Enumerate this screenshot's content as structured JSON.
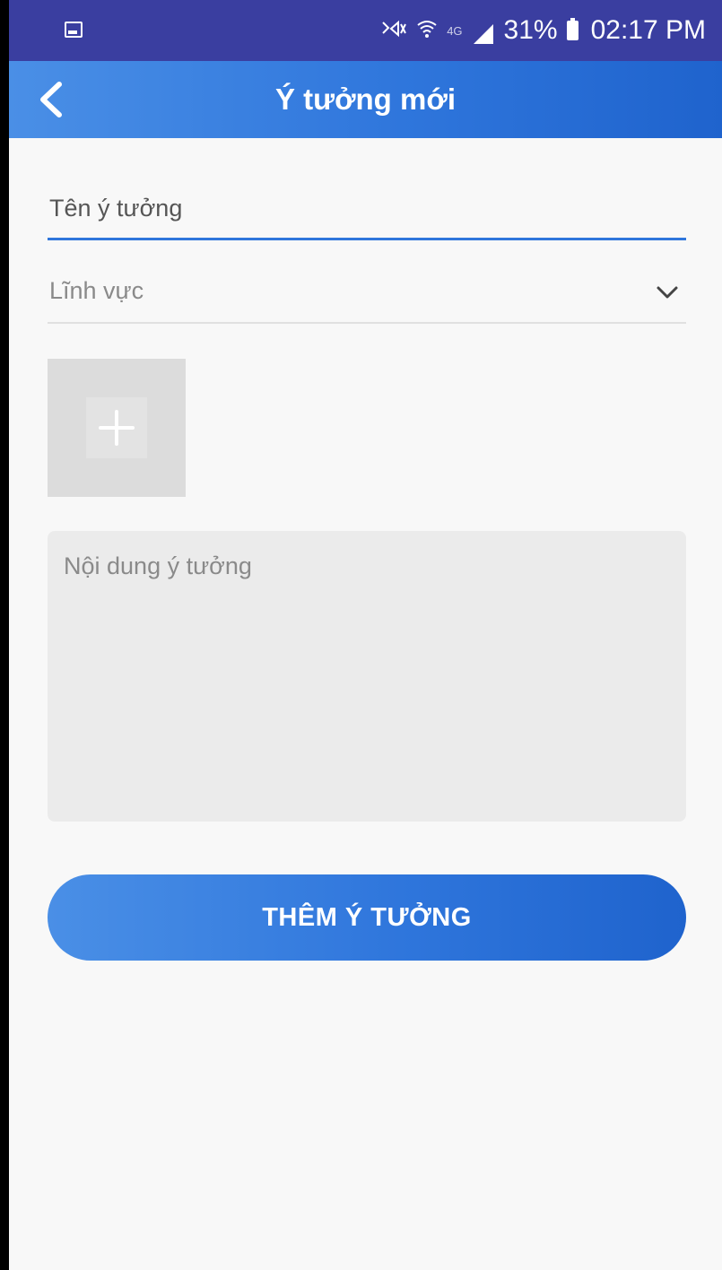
{
  "status_bar": {
    "battery": "31%",
    "time": "02:17 PM",
    "network_label": "4G",
    "icons": [
      "gallery-icon",
      "mute-icon",
      "wifi-icon",
      "signal-icon",
      "battery-icon"
    ]
  },
  "app_bar": {
    "title": "Ý tưởng mới",
    "back_icon": "chevron-left-icon"
  },
  "form": {
    "name_placeholder": "Tên ý tưởng",
    "name_value": "",
    "sector_label": "Lĩnh vực",
    "sector_icon": "chevron-down-icon",
    "add_image_icon": "plus-icon",
    "content_placeholder": "Nội dung ý tưởng",
    "content_value": ""
  },
  "actions": {
    "submit_label": "THÊM Ý TƯỞNG"
  },
  "colors": {
    "status_bar": "#3a3ea0",
    "accent": "#2f76dc",
    "accent_dark": "#1f63cd",
    "accent_light": "#4a8fe6",
    "background": "#f8f8f8"
  }
}
